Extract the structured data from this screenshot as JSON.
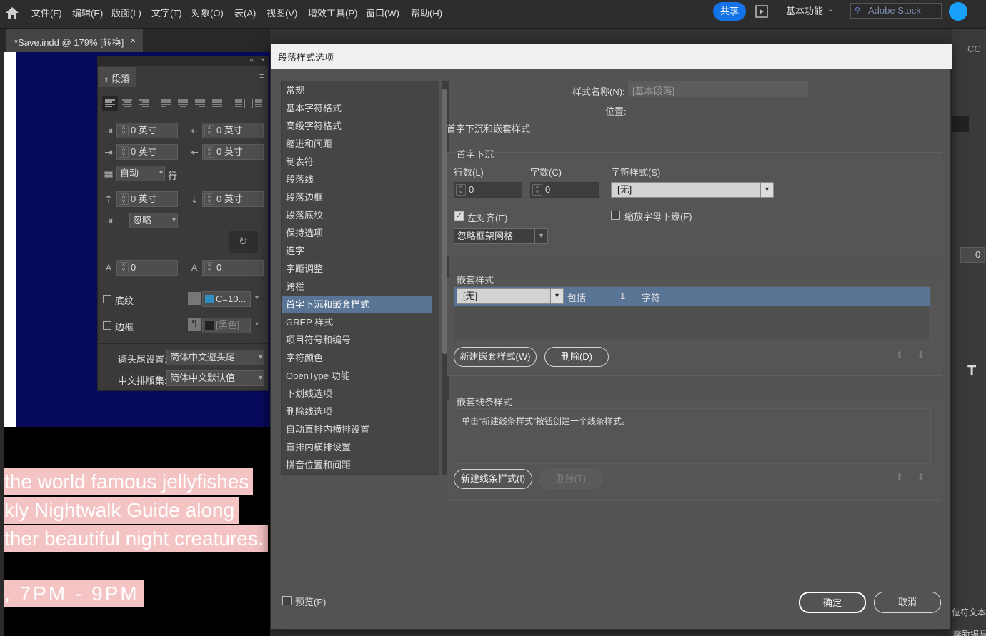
{
  "menubar": {
    "items": [
      "文件(F)",
      "编辑(E)",
      "版面(L)",
      "文字(T)",
      "对象(O)",
      "表(A)",
      "视图(V)",
      "增效工具(P)",
      "窗口(W)",
      "帮助(H)"
    ],
    "share": "共享",
    "workspace": "基本功能",
    "stock_placeholder": "Adobe Stock"
  },
  "document": {
    "tab_title": "*Save.indd @ 179% [转换]",
    "lines": [
      "the world famous jellyfishes",
      "kly Nightwalk Guide along",
      "ther beautiful night creatures.",
      ", 7PM - 9PM"
    ]
  },
  "paragraph_panel": {
    "tab": "段落",
    "left_indent": "0 英寸",
    "right_indent": "0 英寸",
    "first_line_indent": "0 英寸",
    "last_line_indent": "0 英寸",
    "grid_align": "自动",
    "grid_unit": "行",
    "space_before": "0 英寸",
    "space_after": "0 英寸",
    "ignore": "忽略",
    "drop_lines": "0",
    "drop_chars": "0",
    "shading_label": "底纹",
    "shading_color": "C=10...",
    "border_label": "边框",
    "border_color": "[黑色]",
    "kinsoku_label": "避头尾设置:",
    "kinsoku_value": "简体中文避头尾",
    "mojikumi_label": "中文排版集:",
    "mojikumi_value": "简体中文默认值"
  },
  "right_panel": {
    "cc": "CC",
    "field": "0",
    "bottom": "位符文本",
    "bottom2": "季新编写"
  },
  "dialog": {
    "title": "段落样式选项",
    "categories": [
      "常规",
      "基本字符格式",
      "高级字符格式",
      "缩进和间距",
      "制表符",
      "段落线",
      "段落边框",
      "段落底纹",
      "保持选项",
      "连字",
      "字距调整",
      "跨栏",
      "首字下沉和嵌套样式",
      "GREP 样式",
      "项目符号和编号",
      "字符颜色",
      "OpenType 功能",
      "下划线选项",
      "删除线选项",
      "自动直排内横排设置",
      "直排内横排设置",
      "拼音位置和间距"
    ],
    "selected_index": 12,
    "style_name_label": "样式名称(N):",
    "style_name_value": "[基本段落]",
    "location_label": "位置:",
    "section_title": "首字下沉和嵌套样式",
    "drop_cap": {
      "group": "首字下沉",
      "lines_label": "行数(L)",
      "lines_value": "0",
      "chars_label": "字数(C)",
      "chars_value": "0",
      "charstyle_label": "字符样式(S)",
      "charstyle_value": "[无]",
      "align_left": "左对齐(E)",
      "scale_descenders": "缩放字母下缘(F)",
      "frame_grid": "忽略框架网格"
    },
    "nested": {
      "group": "嵌套样式",
      "style": "[无]",
      "through": "包括",
      "count": "1",
      "unit": "字符",
      "new_btn": "新建嵌套样式(W)",
      "delete_btn": "删除(D)"
    },
    "nested_line": {
      "group": "嵌套线条样式",
      "hint": "单击“新建线条样式”按钮创建一个线条样式。",
      "new_btn": "新建线条样式(I)",
      "delete_btn": "删除(T)"
    },
    "preview": "预览(P)",
    "ok": "确定",
    "cancel": "取消"
  }
}
